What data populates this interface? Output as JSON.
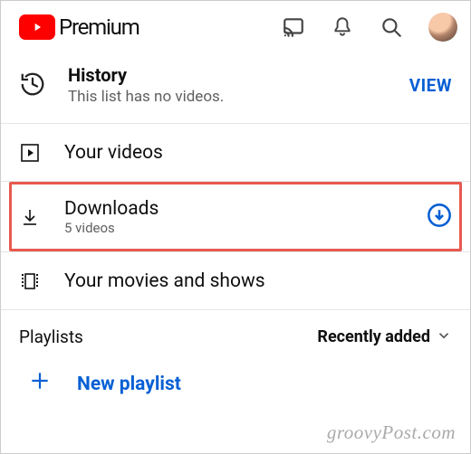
{
  "header": {
    "brand": "Premium"
  },
  "history": {
    "title": "History",
    "subtitle": "This list has no videos.",
    "action": "VIEW"
  },
  "rows": {
    "your_videos": {
      "title": "Your videos"
    },
    "downloads": {
      "title": "Downloads",
      "subtitle": "5 videos"
    },
    "movies": {
      "title": "Your movies and shows"
    }
  },
  "playlists": {
    "label": "Playlists",
    "sort": "Recently added",
    "new_label": "New playlist"
  },
  "watermark": "groovyPost.com"
}
